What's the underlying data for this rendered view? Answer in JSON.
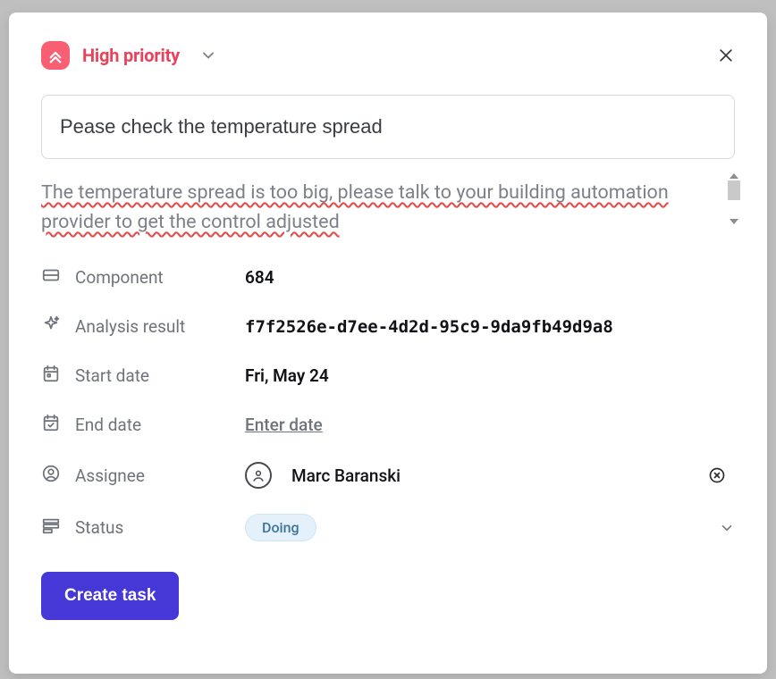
{
  "priority": {
    "label": "High priority"
  },
  "title": "Pease check the temperature spread",
  "description": "The temperature spread is too big, please talk to your building automation provider to get the control adjusted",
  "fields": {
    "component": {
      "label": "Component",
      "value": "684"
    },
    "analysis_result": {
      "label": "Analysis result",
      "value": "f7f2526e-d7ee-4d2d-95c9-9da9fb49d9a8"
    },
    "start_date": {
      "label": "Start date",
      "value": "Fri, May 24"
    },
    "end_date": {
      "label": "End date",
      "placeholder": "Enter date"
    },
    "assignee": {
      "label": "Assignee",
      "name": "Marc Baranski"
    },
    "status": {
      "label": "Status",
      "value": "Doing"
    }
  },
  "buttons": {
    "create": "Create task"
  }
}
